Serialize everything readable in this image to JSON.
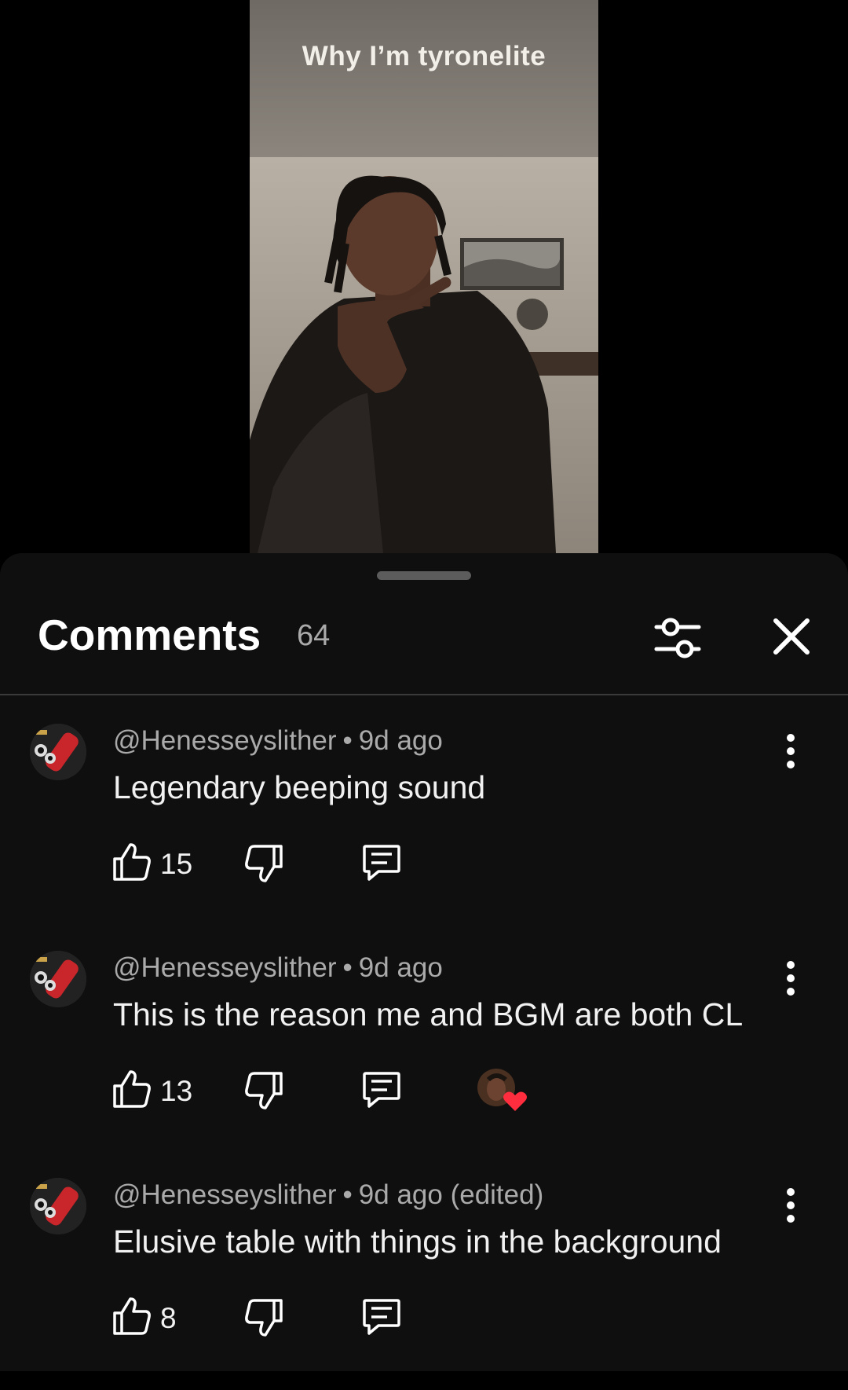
{
  "video": {
    "caption": "Why I’m tyronelite"
  },
  "comments_panel": {
    "title": "Comments",
    "count": "64"
  },
  "comments": [
    {
      "author": "@Henesseyslither",
      "separator": "•",
      "time": "9d ago",
      "text": "Legendary beeping sound",
      "likes": "15",
      "creator_hearted": false
    },
    {
      "author": "@Henesseyslither",
      "separator": "•",
      "time": "9d ago",
      "text": "This is the reason me and BGM are both CL",
      "likes": "13",
      "creator_hearted": true
    },
    {
      "author": "@Henesseyslither",
      "separator": "•",
      "time": "9d ago (edited)",
      "text": "Elusive table with things in the background",
      "likes": "8",
      "creator_hearted": false
    }
  ],
  "icons": {
    "filter": "filter-sliders-icon",
    "close": "close-icon",
    "more": "more-vert-icon",
    "like": "thumb-up-icon",
    "dislike": "thumb-down-icon",
    "reply": "reply-comment-icon",
    "heart": "heart-icon"
  },
  "colors": {
    "sheet_background": "#0f0f0f",
    "heart": "#ff2d3d",
    "secondary_text": "#aaaaaa"
  }
}
